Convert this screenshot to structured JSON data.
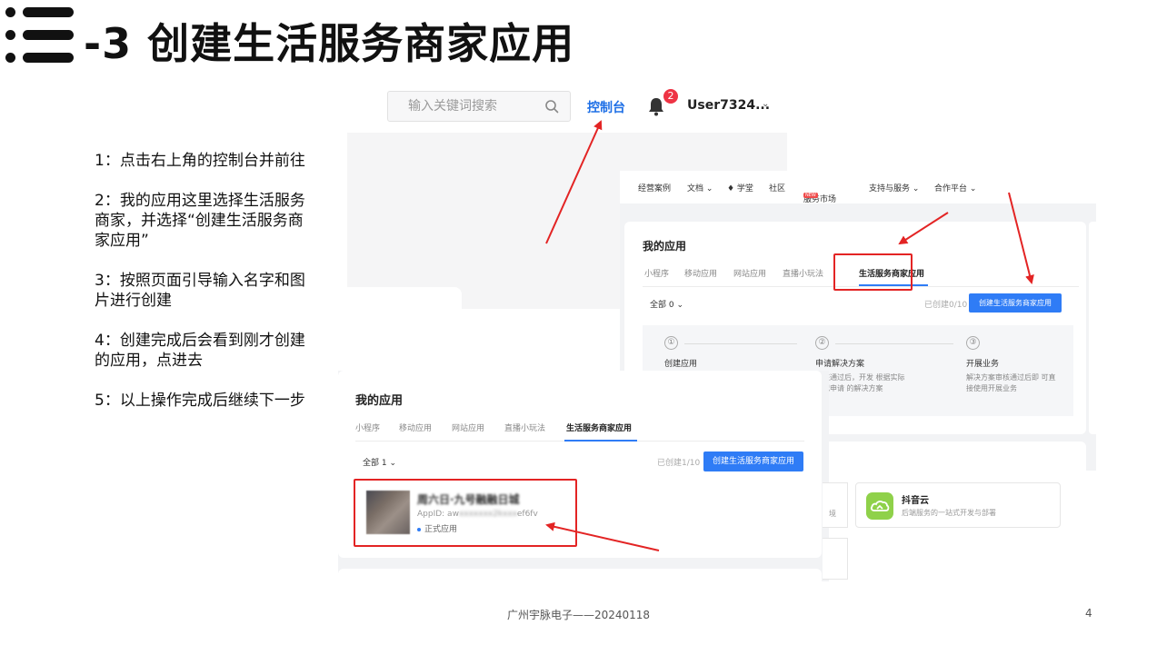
{
  "slide": {
    "title": "-3 创建生活服务商家应用",
    "steps": [
      "1：点击右上角的控制台并前往",
      "2：我的应用这里选择生活服务商家，并选择“创建生活服务商家应用”",
      "3：按照页面引导输入名字和图片进行创建",
      "4：创建完成后会看到刚才创建的应用，点进去",
      "5：以上操作完成后继续下一步"
    ],
    "footer": "广州宇脉电子——20240118",
    "page_number": "4"
  },
  "console_header": {
    "search_placeholder": "输入关键词搜索",
    "console_label": "控制台",
    "notification_count": "2",
    "user_name": "User7324...",
    "user_chevron": "⌄"
  },
  "top_nav": {
    "items": [
      "经营案例",
      "文档 ⌄",
      "♦ 学堂",
      "社区",
      "服务市场",
      "支持与服务 ⌄",
      "合作平台 ⌄"
    ],
    "new_badge": "NEW"
  },
  "my_apps_empty": {
    "heading": "我的应用",
    "tabs": [
      "小程序",
      "移动应用",
      "网站应用",
      "直播小玩法",
      "生活服务商家应用"
    ],
    "filter": "全部 0 ⌄",
    "count": "已创建0/10",
    "create_button": "创建生活服务商家应用",
    "guide_steps": [
      {
        "num": "①",
        "title": "创建应用",
        "desc": ""
      },
      {
        "num": "②",
        "title": "申请解决方案",
        "desc": "审核通过后，开发 根据实际情况申请 的解决方案"
      },
      {
        "num": "③",
        "title": "开展业务",
        "desc": "解决方案审核通过后即 可直接使用开展业务"
      }
    ]
  },
  "my_apps_created": {
    "heading": "我的应用",
    "tabs": [
      "小程序",
      "移动应用",
      "网站应用",
      "直播小玩法",
      "生活服务商家应用"
    ],
    "filter": "全部 1 ⌄",
    "count": "已创建1/10",
    "create_button": "创建生活服务商家应用",
    "app": {
      "name": "周六日·九号融融日城",
      "id_prefix": "AppID: aw",
      "id_hidden": "xxxxxxx2kxxx",
      "id_suffix": "ef6fv",
      "status": "正式应用"
    }
  },
  "cloud_tile": {
    "title": "抖音云",
    "desc": "后端服务的一站式开发与部署",
    "partial": "境"
  },
  "colors": {
    "accent": "#2f7cf6",
    "console_link": "#1e6fe6",
    "highlight": "#e32424",
    "badge": "#ee3344"
  }
}
